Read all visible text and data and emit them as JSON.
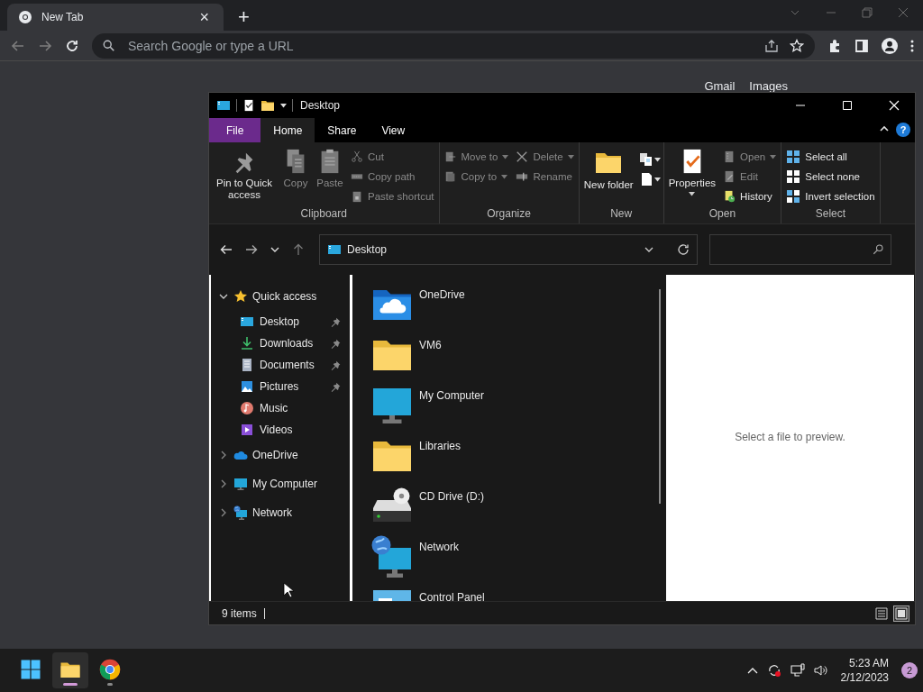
{
  "browser": {
    "tab": {
      "title": "New Tab",
      "close": "×"
    },
    "new_tab": "+",
    "omnibox": {
      "placeholder": "Search Google or type a URL"
    },
    "top_links": [
      "Gmail",
      "Images"
    ]
  },
  "explorer": {
    "title": "Desktop",
    "ribbon_tabs": [
      {
        "label": "File",
        "kind": "file",
        "selected": false
      },
      {
        "label": "Home",
        "kind": "tab",
        "selected": true
      },
      {
        "label": "Share",
        "kind": "tab",
        "selected": false
      },
      {
        "label": "View",
        "kind": "tab",
        "selected": false
      }
    ],
    "help": "?",
    "ribbon_groups": [
      {
        "label": "Clipboard",
        "columns": [
          {
            "kind": "large",
            "commands": [
              {
                "label": "Pin to Quick access",
                "disabled": false,
                "dropdown": false
              }
            ]
          },
          {
            "kind": "large",
            "commands": [
              {
                "label": "Copy",
                "disabled": true,
                "dropdown": false
              }
            ]
          },
          {
            "kind": "large",
            "commands": [
              {
                "label": "Paste",
                "disabled": true,
                "dropdown": false
              }
            ]
          },
          {
            "kind": "small",
            "commands": [
              {
                "label": "Cut",
                "disabled": true,
                "dropdown": false
              },
              {
                "label": "Copy path",
                "disabled": true,
                "dropdown": false
              },
              {
                "label": "Paste shortcut",
                "disabled": true,
                "dropdown": false
              }
            ]
          }
        ]
      },
      {
        "label": "Organize",
        "columns": [
          {
            "kind": "small",
            "commands": [
              {
                "label": "Move to",
                "disabled": true,
                "dropdown": true
              },
              {
                "label": "Copy to",
                "disabled": true,
                "dropdown": true
              }
            ]
          },
          {
            "kind": "small",
            "commands": [
              {
                "label": "Delete",
                "disabled": true,
                "dropdown": true
              },
              {
                "label": "Rename",
                "disabled": true,
                "dropdown": false
              }
            ]
          }
        ]
      },
      {
        "label": "New",
        "columns": [
          {
            "kind": "large",
            "commands": [
              {
                "label": "New folder",
                "disabled": false,
                "dropdown": false
              }
            ]
          },
          {
            "kind": "icons"
          }
        ]
      },
      {
        "label": "Open",
        "columns": [
          {
            "kind": "large",
            "commands": [
              {
                "label": "Properties",
                "disabled": false,
                "dropdown": true
              }
            ]
          },
          {
            "kind": "small",
            "commands": [
              {
                "label": "Open",
                "disabled": true,
                "dropdown": true
              },
              {
                "label": "Edit",
                "disabled": true,
                "dropdown": false
              },
              {
                "label": "History",
                "disabled": false,
                "dropdown": false
              }
            ]
          }
        ]
      },
      {
        "label": "Select",
        "columns": [
          {
            "kind": "small",
            "commands": [
              {
                "label": "Select all",
                "disabled": false,
                "dropdown": false
              },
              {
                "label": "Select none",
                "disabled": false,
                "dropdown": false
              },
              {
                "label": "Invert selection",
                "disabled": false,
                "dropdown": false
              }
            ]
          }
        ]
      }
    ],
    "address": "Desktop",
    "nav_tree": [
      {
        "label": "Quick access",
        "kind": "star",
        "expanded": true,
        "children": [
          {
            "label": "Desktop",
            "kind": "desktop",
            "pinned": true
          },
          {
            "label": "Downloads",
            "kind": "downloads",
            "pinned": true
          },
          {
            "label": "Documents",
            "kind": "documents",
            "pinned": true
          },
          {
            "label": "Pictures",
            "kind": "pictures",
            "pinned": true
          },
          {
            "label": "Music",
            "kind": "music",
            "pinned": false
          },
          {
            "label": "Videos",
            "kind": "videos",
            "pinned": false
          }
        ]
      },
      {
        "label": "OneDrive",
        "kind": "cloud",
        "expanded": false
      },
      {
        "label": "My Computer",
        "kind": "computer",
        "expanded": false
      },
      {
        "label": "Network",
        "kind": "network",
        "expanded": false
      }
    ],
    "items": [
      {
        "name": "OneDrive",
        "kind": "cloud-folder"
      },
      {
        "name": "VM6",
        "kind": "folder"
      },
      {
        "name": "My Computer",
        "kind": "computer"
      },
      {
        "name": "Libraries",
        "kind": "folder"
      },
      {
        "name": "CD Drive (D:)",
        "kind": "drive"
      },
      {
        "name": "Network",
        "kind": "network"
      },
      {
        "name": "Control Panel",
        "kind": "control-panel"
      }
    ],
    "preview": "Select a file to preview.",
    "status": "9 items",
    "views": [
      {
        "kind": "details",
        "selected": false
      },
      {
        "kind": "large-icons",
        "selected": true
      }
    ]
  },
  "taskbar": {
    "apps": [
      {
        "kind": "explorer",
        "selected": true
      },
      {
        "kind": "chrome",
        "selected": false
      }
    ],
    "time": "5:23 AM",
    "date": "2/12/2023",
    "notifications": "2"
  }
}
